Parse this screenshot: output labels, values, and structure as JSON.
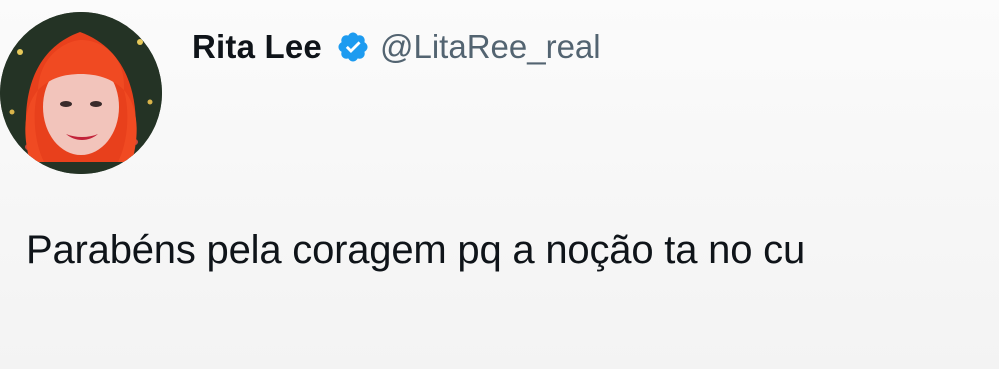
{
  "tweet": {
    "author": {
      "display_name": "Rita Lee",
      "handle": "@LitaRee_real",
      "verified": true,
      "avatar_icon": "profile-photo-red-hair",
      "verified_badge_color": "#1d9bf0"
    },
    "text": "Parabéns pela coragem pq a noção ta no cu"
  }
}
